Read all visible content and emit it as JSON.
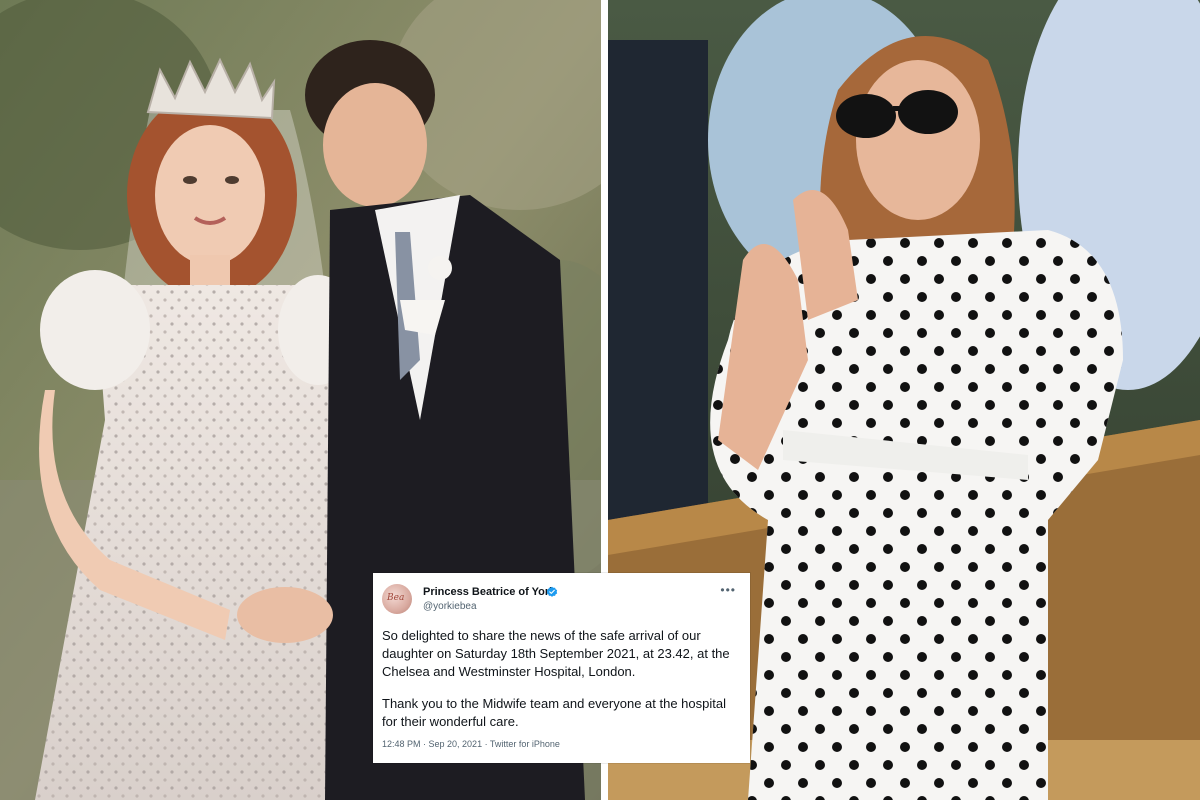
{
  "photos": {
    "left": {
      "icon": "wedding-photo"
    },
    "right": {
      "icon": "polka-dot-dress-photo"
    }
  },
  "tweet": {
    "display_name": "Princess Beatrice of York",
    "handle": "@yorkiebea",
    "avatar_text": "Bea",
    "paragraph1": "So delighted to share the news of the safe arrival of our daughter on Saturday 18th September 2021, at 23.42, at the Chelsea and Westminster Hospital, London.",
    "paragraph2": "Thank you to the Midwife team and everyone at the hospital for their wonderful care.",
    "meta": "12:48 PM · Sep 20, 2021 · Twitter for iPhone",
    "more_icon": "more-dots-icon",
    "verified_icon": "verified-badge-icon",
    "colors": {
      "verified": "#1d9bf0",
      "text": "#0f1419",
      "muted": "#536471"
    }
  }
}
